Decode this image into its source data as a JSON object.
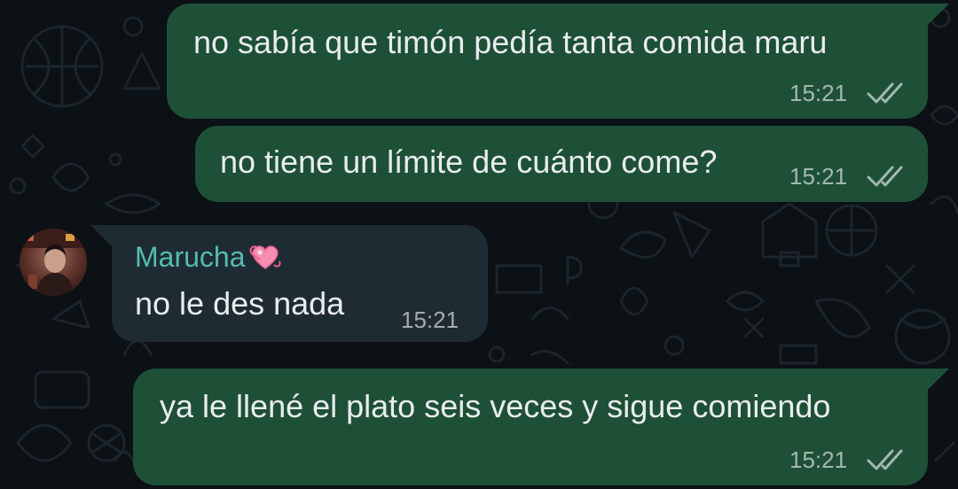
{
  "chat": {
    "messages": [
      {
        "direction": "outgoing",
        "text": "no sabía que timón pedía tanta comida maru",
        "time": "15:21",
        "status": "read-double-check"
      },
      {
        "direction": "outgoing",
        "text": "no tiene un límite de cuánto come?",
        "time": "15:21",
        "status": "read-double-check"
      },
      {
        "direction": "incoming",
        "sender": "Marucha",
        "sender_emoji": "heart-icon",
        "text": "no le des nada",
        "time": "15:21"
      },
      {
        "direction": "outgoing",
        "text": "ya le llené el plato seis veces y sigue comiendo",
        "time": "15:21",
        "status": "read-double-check"
      }
    ]
  },
  "colors": {
    "background": "#0b1115",
    "outgoing_bubble": "#1e5037",
    "incoming_bubble": "#1f2b32",
    "sender_name": "#53bdae",
    "text": "#e9edef",
    "meta_text": "#a8b2b7"
  }
}
